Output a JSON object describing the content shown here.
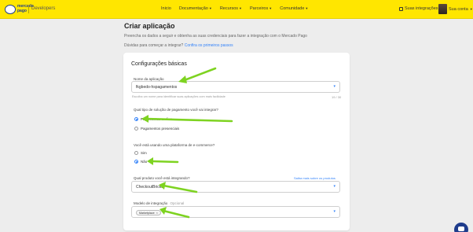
{
  "topbar": {
    "logo_text": "mercado pago",
    "brand_sub": "Developers",
    "nav": [
      {
        "label": "Inicio",
        "dropdown": false
      },
      {
        "label": "Documentação",
        "dropdown": true
      },
      {
        "label": "Recursos",
        "dropdown": true
      },
      {
        "label": "Parceiros",
        "dropdown": true
      },
      {
        "label": "Comunidade",
        "dropdown": true
      }
    ],
    "integrations_label": "Suas integrações",
    "account_label": "Sua conta",
    "accent_color": "#ffe600"
  },
  "header": {
    "title": "Criar aplicação",
    "description": "Preencha os dados a seguir e obtenha as suas credenciais para fazer a integração com o Mercado Pago",
    "help_prefix": "Dúvidas para começar a integrar?",
    "help_link": "Confira os primeiros passos"
  },
  "form": {
    "section_title": "Configurações básicas",
    "app_name": {
      "label": "Nome da aplicação",
      "value": "fkgbedo-hspagamentos",
      "hint": "Escolha um nome para identificar suas aplicações com mais facilidade",
      "counter": "19 / 30"
    },
    "payment_type": {
      "question": "Qual tipo de solução de pagamento você vai integrar?",
      "options": [
        "Pagamentos on-line",
        "Pagamentos presenciais"
      ],
      "selected_index": 0
    },
    "ecommerce": {
      "question": "Você está usando uma plataforma de e-commerce?",
      "options": [
        "Sim",
        "Não"
      ],
      "selected_index": 1
    },
    "product": {
      "label": "Qual produto você está integrando?",
      "link": "Saiba mais sobre os produtos",
      "value": "CheckoutBricks"
    },
    "integration_model": {
      "label": "Modelo de integração",
      "optional": "Opcional",
      "chip": "Marketplace"
    }
  },
  "icons": {
    "dropdown": "chevron-down-icon",
    "chip_remove": "close-icon",
    "chat": "chat-icon"
  },
  "annotation_color": "#7ed321"
}
